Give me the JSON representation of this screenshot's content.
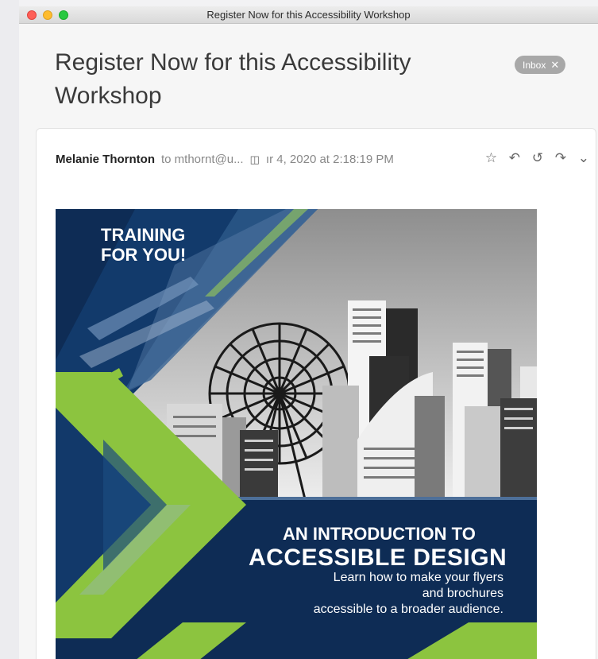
{
  "window": {
    "title": "Register Now for this Accessibility Workshop"
  },
  "message": {
    "subject": "Register Now for this Accessibility Workshop",
    "mailbox_badge": "Inbox",
    "badge_close_glyph": "✕",
    "sender": "Melanie Thornton",
    "recipient": "to mthornt@u...",
    "date": "ır 4, 2020 at 2:18:19 PM"
  },
  "icons": {
    "attachment": "attachment-icon",
    "flag": "star-icon",
    "reply": "reply-icon",
    "reply_all": "reply-all-icon",
    "forward": "forward-icon",
    "more": "chevron-down-icon"
  },
  "flyer": {
    "badge_line1": "TRAINING",
    "badge_line2": "FOR YOU!",
    "intro": "AN INTRODUCTION TO",
    "title": "ACCESSIBLE DESIGN",
    "sub_line1": "Learn how to make your flyers",
    "sub_line2": "and brochures",
    "sub_line3": "accessible to a broader audience.",
    "colors": {
      "navy": "#0e2c55",
      "green": "#8cc43f",
      "steel_blue": "#5577a0"
    }
  }
}
